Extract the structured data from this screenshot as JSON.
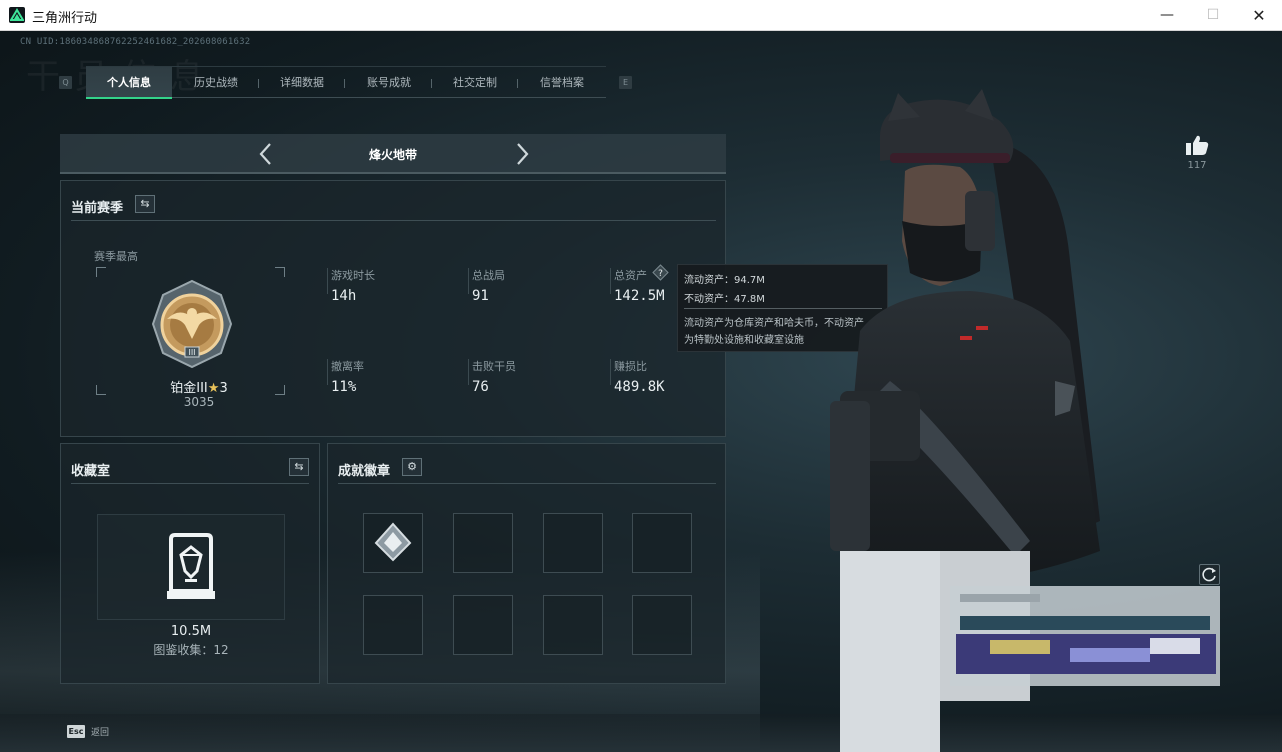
{
  "window": {
    "title": "三角洲行动",
    "minimize": "—",
    "maximize": "☐",
    "close": "✕"
  },
  "uid": "CN UID:18603486876225246168​2_202608061632",
  "tabs": {
    "prev_key": "Q",
    "next_key": "E",
    "items": [
      "个人信息",
      "历史战绩",
      "详细数据",
      "账号成就",
      "社交定制",
      "信誉档案"
    ],
    "active_index": 0
  },
  "mode": {
    "title": "烽火地带"
  },
  "season": {
    "title": "当前赛季",
    "best_label": "赛季最高",
    "rank_name": "铂金III",
    "rank_stars": "3",
    "rank_score": "3035",
    "stats": [
      {
        "label": "游戏时长",
        "value": "14h"
      },
      {
        "label": "总战局",
        "value": "91"
      },
      {
        "label": "总资产",
        "value": "142.5M"
      },
      {
        "label": "撤离率",
        "value": "11%"
      },
      {
        "label": "击败干员",
        "value": "76"
      },
      {
        "label": "赚损比",
        "value": "489.8K"
      }
    ]
  },
  "tooltip": {
    "line1": "流动资产：94.7M",
    "line2": "不动资产：47.8M",
    "desc1": "流动资产为仓库资产和哈夫币，不动资产",
    "desc2": "为特勤处设施和收藏室设施"
  },
  "collection": {
    "title": "收藏室",
    "value": "10.5M",
    "count_label": "图鉴收集：12"
  },
  "achievements": {
    "title": "成就徽章",
    "slots": 8,
    "filled": 1
  },
  "likes": {
    "count": "117"
  },
  "footer": {
    "esc_key": "Esc",
    "esc_label": "返回"
  },
  "colors": {
    "accent": "#33d38a",
    "panel": "#1a252b",
    "text": "#e9eff1"
  }
}
